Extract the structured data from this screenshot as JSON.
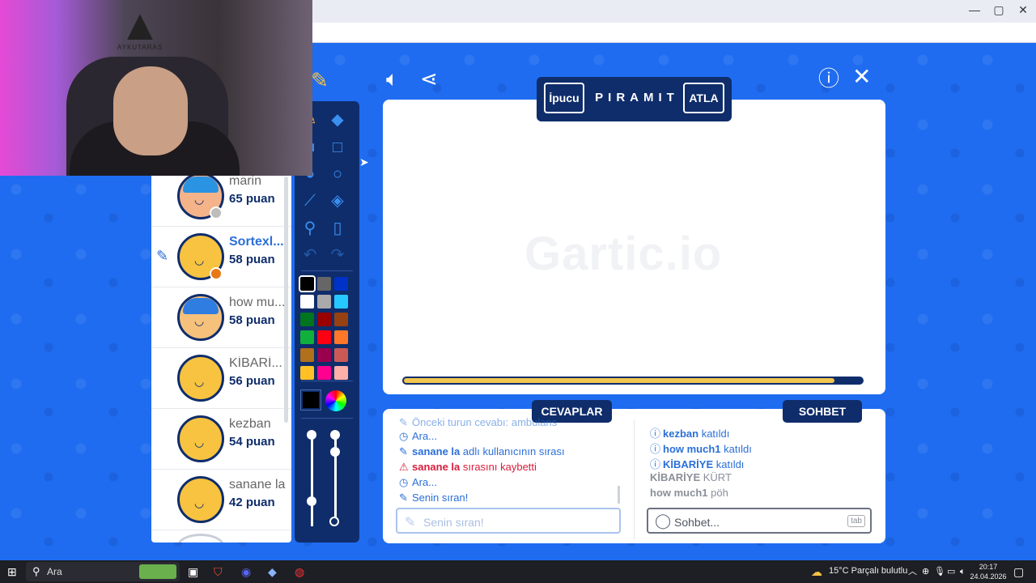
{
  "browser": {
    "minimize": "—",
    "restore": "▢",
    "close": "✕"
  },
  "webcam": {
    "logo_text": "AYKUTARAS"
  },
  "game": {
    "hint_button": "İpucu",
    "word": "PIRAMIT",
    "skip_button": "ATLA",
    "watermark": "Gartic.io",
    "timer_fraction": 0.94
  },
  "players": [
    {
      "name": "marin",
      "score": "65 puan",
      "status": "#bdbdbd"
    },
    {
      "name": "Sortexl...",
      "score": "58 puan",
      "status": "#e87817",
      "drawing": true
    },
    {
      "name": "how mu...",
      "score": "58 puan"
    },
    {
      "name": "KİBARİ...",
      "score": "56 puan"
    },
    {
      "name": "kezban",
      "score": "54 puan"
    },
    {
      "name": "sanane la",
      "score": "42 puan"
    }
  ],
  "palette": {
    "colors": [
      "#000000",
      "#666666",
      "#0032c8",
      "#ffffff",
      "#aaaaaa",
      "#26c9ff",
      "#017420",
      "#990000",
      "#964112",
      "#11b03c",
      "#ff0013",
      "#ff7829",
      "#b0701c",
      "#99004e",
      "#cb5a57",
      "#ffc126",
      "#ff008f",
      "#feafa8"
    ],
    "selected": 0
  },
  "answers": {
    "header": "CEVAPLAR",
    "cut_line": "Önceki turun cevabı: ambulans",
    "messages": [
      {
        "icon": "clock",
        "text": "Ara...",
        "type": "blue"
      },
      {
        "icon": "pencil",
        "bold": "sanane la",
        "text": " adlı kullanıcının sırası",
        "type": "blue"
      },
      {
        "icon": "warning",
        "bold": "sanane la",
        "text": " sırasını kaybetti",
        "type": "red"
      },
      {
        "icon": "clock",
        "text": "Ara...",
        "type": "blue"
      },
      {
        "icon": "pencil",
        "text": "Senin sıran!",
        "type": "blue"
      }
    ],
    "input_placeholder": "Senin sıran!"
  },
  "chat": {
    "header": "SOHBET",
    "messages": [
      {
        "icon": "info",
        "bold": "kezban",
        "text": " katıldı",
        "type": "blue"
      },
      {
        "icon": "info",
        "bold": "how much1",
        "text": " katıldı",
        "type": "blue"
      },
      {
        "icon": "info",
        "bold": "KİBARİYE",
        "text": " katıldı",
        "type": "blue"
      },
      {
        "bold": "KİBARİYE",
        "text": " KÜRT",
        "type": "gray"
      },
      {
        "bold": "how much1",
        "text": " pöh",
        "type": "gray"
      }
    ],
    "input_placeholder": "Sohbet...",
    "tab_hint": "tab"
  },
  "taskbar": {
    "search_label": "Ara",
    "weather": "15°C  Parçalı bulutlu",
    "time": "20:17",
    "date": "24.04.2026"
  }
}
